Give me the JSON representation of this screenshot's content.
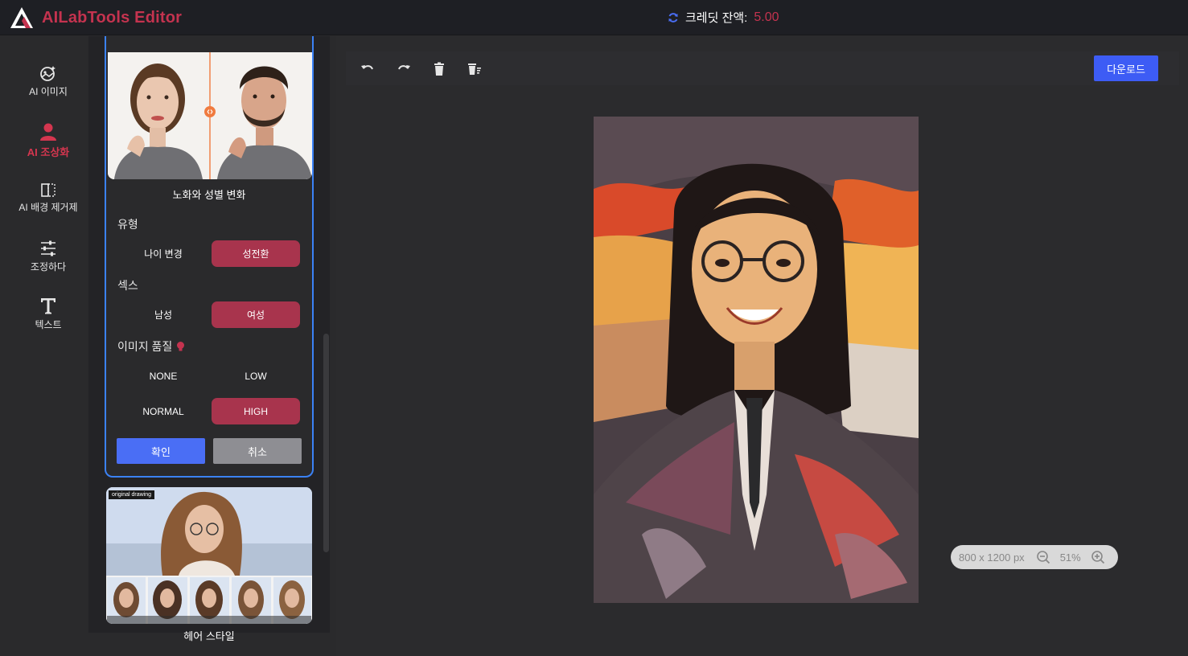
{
  "header": {
    "app_name": "AILabTools Editor",
    "credit_label": "크레딧 잔액:",
    "credit_value": "5.00"
  },
  "nav": {
    "items": [
      {
        "label": "AI 이미지",
        "icon": "ai-image-icon"
      },
      {
        "label": "AI 조상화",
        "icon": "portrait-icon",
        "active": true
      },
      {
        "label": "AI 배경 제거제",
        "icon": "background-remove-icon"
      },
      {
        "label": "조정하다",
        "icon": "sliders-icon"
      },
      {
        "label": "텍스트",
        "icon": "text-icon"
      }
    ]
  },
  "panel": {
    "card1": {
      "title": "노화와 성별 변화",
      "type_label": "유형",
      "type_options": [
        "나이 변경",
        "성전환"
      ],
      "type_selected": "성전환",
      "sex_label": "섹스",
      "sex_options": [
        "남성",
        "여성"
      ],
      "sex_selected": "여성",
      "quality_label": "이미지 품질",
      "quality_options": [
        "NONE",
        "LOW",
        "NORMAL",
        "HIGH"
      ],
      "quality_selected": "HIGH",
      "confirm_label": "확인",
      "cancel_label": "취소"
    },
    "card2": {
      "badge": "original drawing",
      "title": "헤어 스타일"
    }
  },
  "toolbar": {
    "download_label": "다운로드",
    "icons": [
      "undo-icon",
      "redo-icon",
      "delete-icon",
      "clear-all-icon"
    ]
  },
  "zoom": {
    "size_label": "800 x 1200 px",
    "percent": "51%"
  },
  "colors": {
    "brand": "#c4334f",
    "accent_blue": "#3d5cf5",
    "selected_option": "#a8344d",
    "card_border": "#3b82f6"
  }
}
